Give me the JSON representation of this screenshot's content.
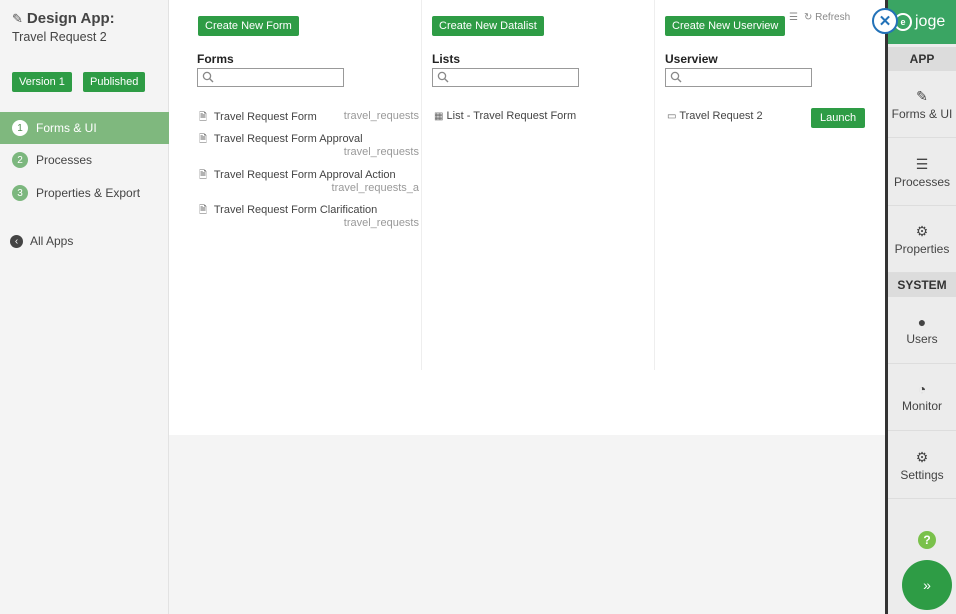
{
  "app": {
    "title": "Design App:",
    "name": "Travel Request 2",
    "version": "Version 1",
    "status": "Published"
  },
  "steps": [
    {
      "num": "1",
      "label": "Forms & UI"
    },
    {
      "num": "2",
      "label": "Processes"
    },
    {
      "num": "3",
      "label": "Properties & Export"
    }
  ],
  "all_apps": "All Apps",
  "forms": {
    "create_label": "Create New Form",
    "title": "Forms",
    "search_placeholder": "",
    "items": [
      {
        "name": "Travel Request Form",
        "table": "travel_requests"
      },
      {
        "name": "Travel Request Form Approval",
        "table": "travel_requests"
      },
      {
        "name": "Travel Request Form Approval Action",
        "table": "travel_requests_a"
      },
      {
        "name": "Travel Request Form Clarification",
        "table": "travel_requests"
      }
    ]
  },
  "lists": {
    "create_label": "Create New Datalist",
    "title": "Lists",
    "search_placeholder": "",
    "items": [
      {
        "name": "List - Travel Request Form"
      }
    ]
  },
  "userview": {
    "create_label": "Create New Userview",
    "title": "Userview",
    "search_placeholder": "",
    "items": [
      {
        "name": "Travel Request 2",
        "launch_label": "Launch"
      }
    ]
  },
  "toolbar": {
    "refresh_label": "Refresh"
  },
  "right_nav": {
    "logo": "joge",
    "app_header": "APP",
    "system_header": "SYSTEM",
    "items": {
      "forms": "Forms & UI",
      "processes": "Processes",
      "properties": "Properties",
      "users": "Users",
      "monitor": "Monitor",
      "settings": "Settings"
    },
    "help": "?"
  },
  "colors": {
    "brand_green": "#2e9c45",
    "active_step": "#7fb87e",
    "close_blue": "#2372b8"
  }
}
